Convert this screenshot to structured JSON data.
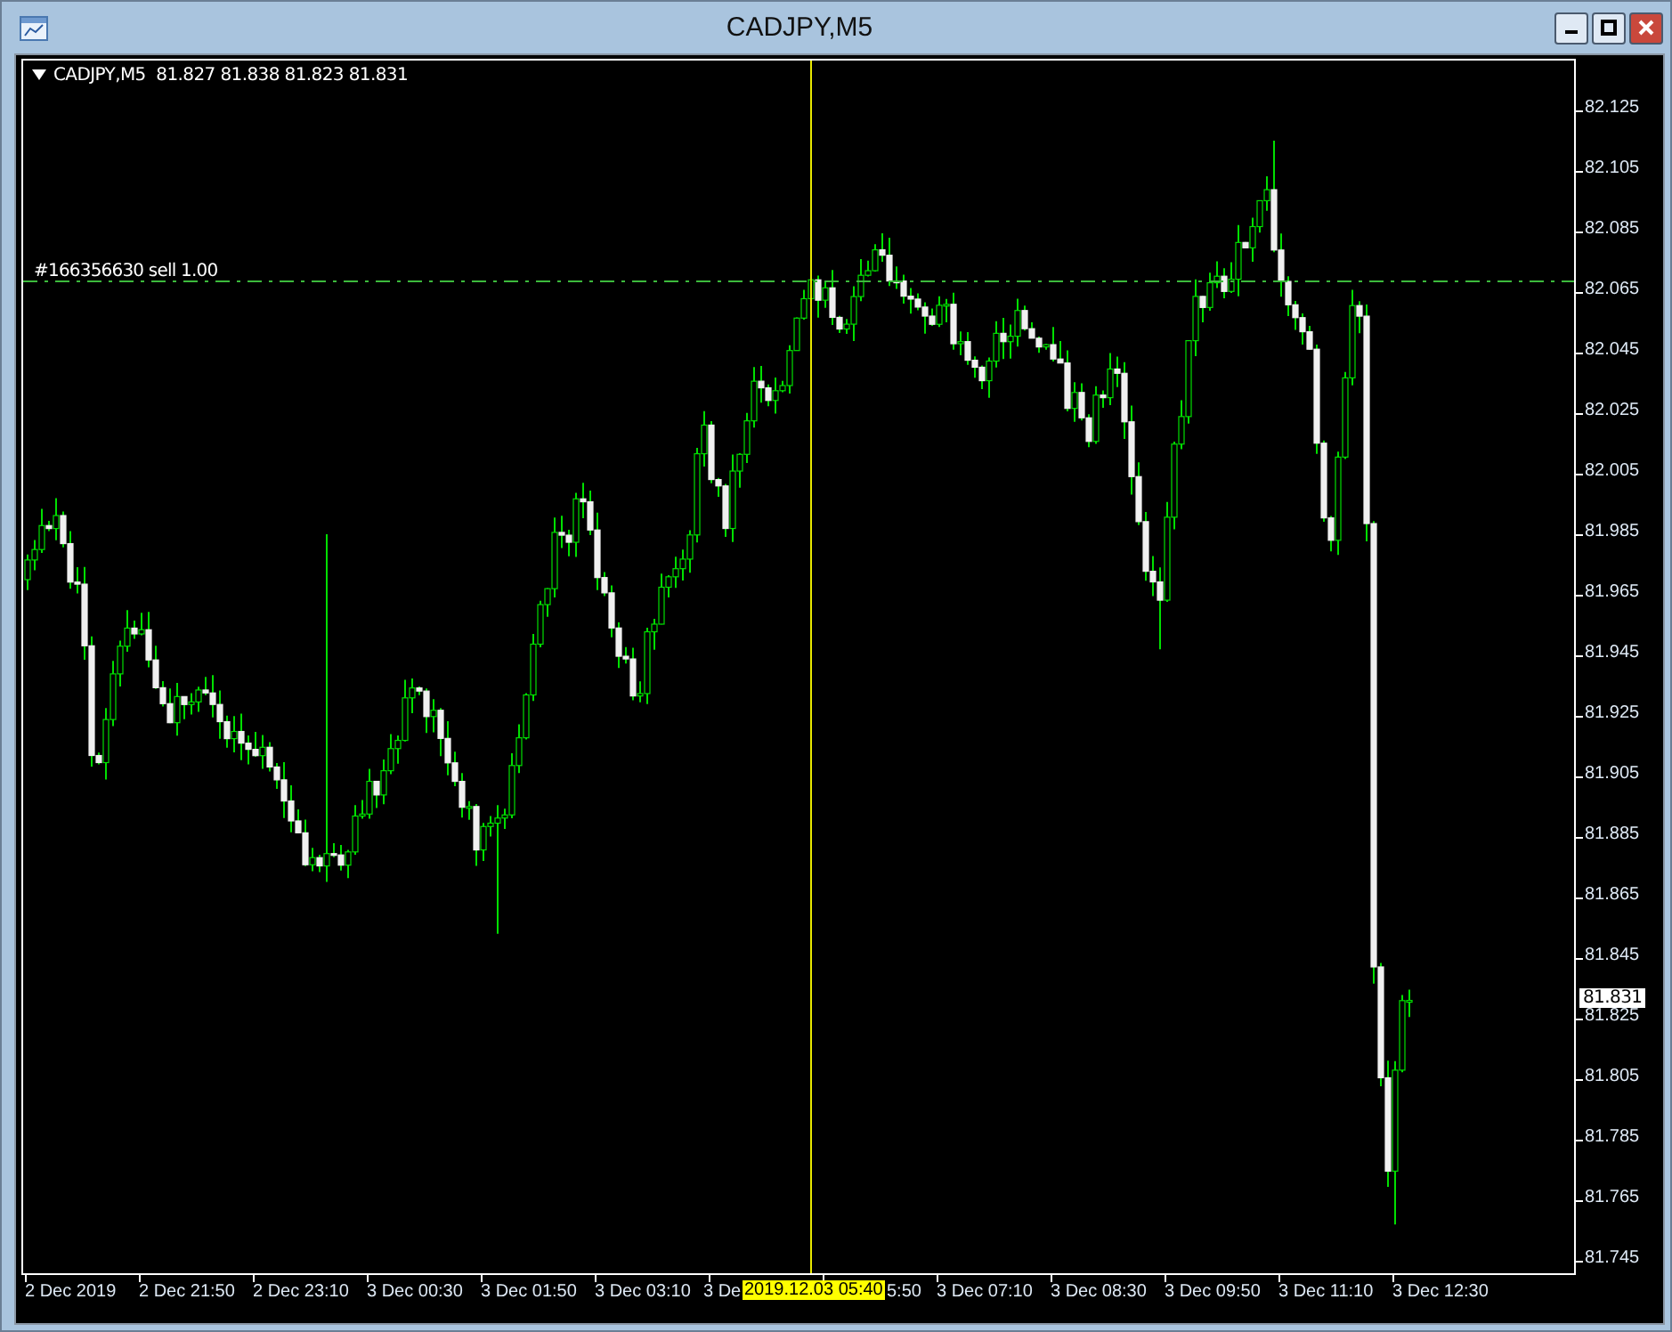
{
  "window": {
    "title": "CADJPY,M5"
  },
  "chart": {
    "symbol": "CADJPY,M5",
    "ohlc": "81.827 81.838 81.823 81.831",
    "order_label": "#166356630 sell 1.00",
    "price_ticks": [
      "82.125",
      "82.105",
      "82.085",
      "82.065",
      "82.045",
      "82.025",
      "82.005",
      "81.985",
      "81.965",
      "81.945",
      "81.925",
      "81.905",
      "81.885",
      "81.865",
      "81.845",
      "81.825",
      "81.805",
      "81.785",
      "81.765",
      "81.745"
    ],
    "bid_label": "81.831",
    "time_ticks": [
      "2 Dec 2019",
      "2 Dec 21:50",
      "2 Dec 23:10",
      "3 Dec 00:30",
      "3 Dec 01:50",
      "3 Dec 03:10",
      "3 De"
    ],
    "cursor_time": "2019.12.03 05:40",
    "covered_tick_tail": "5:50",
    "later_time_ticks": [
      "3 Dec 07:10",
      "3 Dec 08:30",
      "3 Dec 09:50",
      "3 Dec 11:10",
      "3 Dec 12:30"
    ]
  }
}
